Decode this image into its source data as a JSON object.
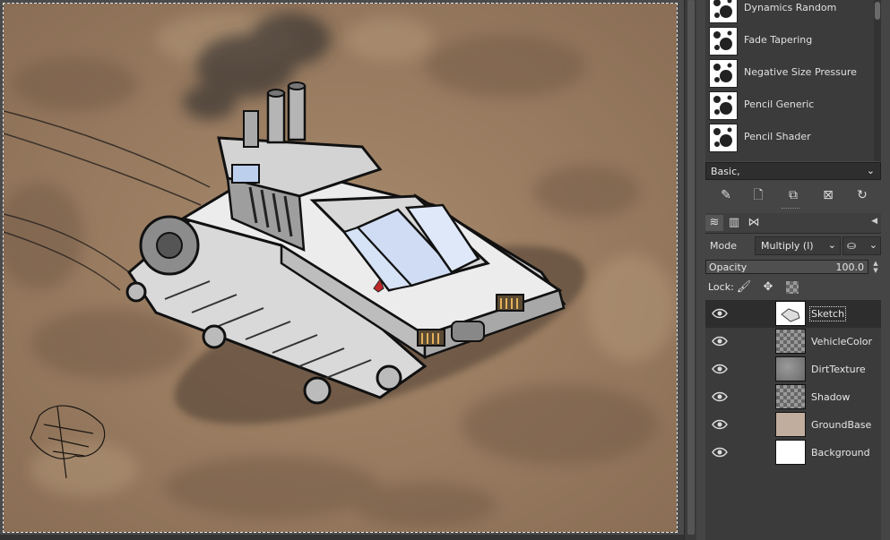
{
  "brushes": {
    "items": [
      {
        "label": "Dynamics Random"
      },
      {
        "label": "Fade Tapering"
      },
      {
        "label": "Negative Size Pressure"
      },
      {
        "label": "Pencil Generic"
      },
      {
        "label": "Pencil Shader"
      }
    ],
    "preset": "Basic,",
    "tool_icons": [
      "edit-brush-icon",
      "new-brush-icon",
      "duplicate-brush-icon",
      "delete-brush-icon",
      "refresh-brushes-icon"
    ]
  },
  "layers_panel": {
    "tabs": [
      "layers-tab-icon",
      "channels-tab-icon",
      "paths-tab-icon"
    ],
    "mode_label": "Mode",
    "mode_value": "Multiply (l)",
    "opacity_label": "Opacity",
    "opacity_value": "100.0",
    "opacity_fraction": 1.0,
    "lock_label": "Lock:",
    "layers": [
      {
        "name": "Sketch",
        "selected": true,
        "thumb": "sketch"
      },
      {
        "name": "VehicleColor",
        "selected": false,
        "thumb": "checker"
      },
      {
        "name": "DirtTexture",
        "selected": false,
        "thumb": "dirt"
      },
      {
        "name": "Shadow",
        "selected": false,
        "thumb": "checker"
      },
      {
        "name": "GroundBase",
        "selected": false,
        "thumb": "ground"
      },
      {
        "name": "Background",
        "selected": false,
        "thumb": "white"
      }
    ]
  },
  "colors": {
    "ground": "#9a7d62",
    "panel_bg": "#454545",
    "selected_row": "#2d2d2d"
  }
}
